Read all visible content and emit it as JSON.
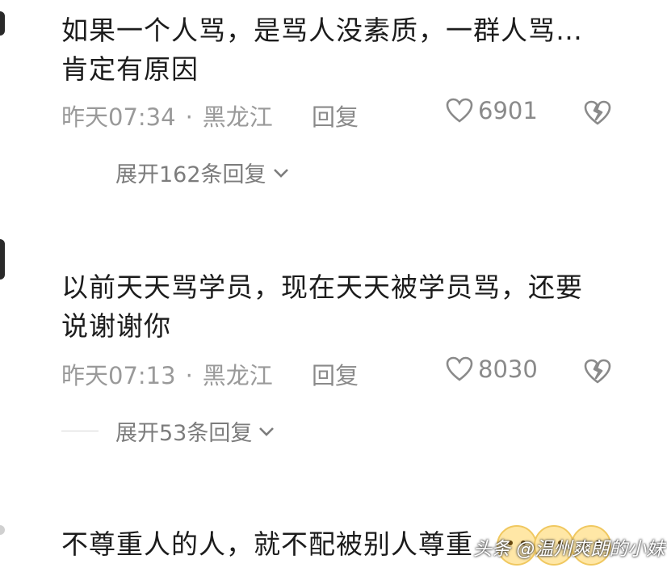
{
  "comments": [
    {
      "text": "如果一个人骂，是骂人没素质，一群人骂…肯定有原因",
      "time": "昨天07:34",
      "separator": "·",
      "location": "黑龙江",
      "reply_label": "回复",
      "likes": "6901",
      "expand_label": "展开162条回复"
    },
    {
      "text": "以前天天骂学员，现在天天被学员骂，还要说谢谢你",
      "time": "昨天07:13",
      "separator": "·",
      "location": "黑龙江",
      "reply_label": "回复",
      "likes": "8030",
      "expand_label": "展开53条回复"
    },
    {
      "text": "不尊重人的人，就不配被别人尊重"
    }
  ],
  "watermark": "头条 @温州爽朗的小妹",
  "icons": {
    "like": "heart-outline-icon",
    "dislike": "broken-heart-icon",
    "expand": "chevron-down-icon"
  }
}
